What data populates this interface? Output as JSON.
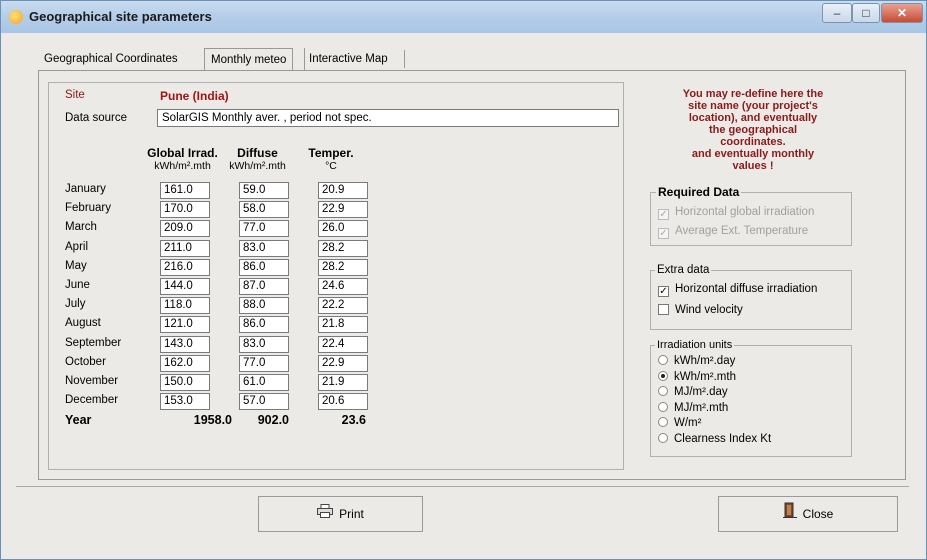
{
  "window": {
    "title": "Geographical site parameters"
  },
  "tabs": [
    "Geographical Coordinates",
    "Monthly meteo",
    "Interactive Map"
  ],
  "site": {
    "label": "Site",
    "value": "Pune    (India)"
  },
  "data_source": {
    "label": "Data source",
    "value": "SolarGIS Monthly aver. , period not spec."
  },
  "columns": [
    {
      "title": "Global Irrad.",
      "unit": "kWh/m².mth"
    },
    {
      "title": "Diffuse",
      "unit": "kWh/m².mth"
    },
    {
      "title": "Temper.",
      "unit": "°C"
    }
  ],
  "months": [
    {
      "name": "January",
      "global": "161.0",
      "diffuse": "59.0",
      "temp": "20.9"
    },
    {
      "name": "February",
      "global": "170.0",
      "diffuse": "58.0",
      "temp": "22.9"
    },
    {
      "name": "March",
      "global": "209.0",
      "diffuse": "77.0",
      "temp": "26.0"
    },
    {
      "name": "April",
      "global": "211.0",
      "diffuse": "83.0",
      "temp": "28.2"
    },
    {
      "name": "May",
      "global": "216.0",
      "diffuse": "86.0",
      "temp": "28.2"
    },
    {
      "name": "June",
      "global": "144.0",
      "diffuse": "87.0",
      "temp": "24.6"
    },
    {
      "name": "July",
      "global": "118.0",
      "diffuse": "88.0",
      "temp": "22.2"
    },
    {
      "name": "August",
      "global": "121.0",
      "diffuse": "86.0",
      "temp": "21.8"
    },
    {
      "name": "September",
      "global": "143.0",
      "diffuse": "83.0",
      "temp": "22.4"
    },
    {
      "name": "October",
      "global": "162.0",
      "diffuse": "77.0",
      "temp": "22.9"
    },
    {
      "name": "November",
      "global": "150.0",
      "diffuse": "61.0",
      "temp": "21.9"
    },
    {
      "name": "December",
      "global": "153.0",
      "diffuse": "57.0",
      "temp": "20.6"
    }
  ],
  "year": {
    "label": "Year",
    "global": "1958.0",
    "diffuse": "902.0",
    "temp": "23.6"
  },
  "info_text": [
    "You may re-define here the",
    "site name (your project's",
    "location),  and eventually",
    "the geographical",
    "coordinates.",
    "and eventually monthly",
    "values !"
  ],
  "required_data": {
    "title": "Required Data",
    "items": [
      {
        "label": "Horizontal global irradiation",
        "checked": true,
        "enabled": false
      },
      {
        "label": "Average Ext. Temperature",
        "checked": true,
        "enabled": false
      }
    ]
  },
  "extra_data": {
    "title": "Extra data",
    "items": [
      {
        "label": "Horizontal diffuse irradiation",
        "checked": true
      },
      {
        "label": "Wind velocity",
        "checked": false
      }
    ]
  },
  "irradiation_units": {
    "title": "Irradiation units",
    "options": [
      "kWh/m².day",
      "kWh/m².mth",
      "MJ/m².day",
      "MJ/m².mth",
      "W/m²",
      "Clearness Index Kt"
    ],
    "selected": "kWh/m².mth"
  },
  "buttons": {
    "print": "Print",
    "close": "Close"
  },
  "icons": {
    "print": "printer-icon",
    "close": "close-door-icon"
  }
}
